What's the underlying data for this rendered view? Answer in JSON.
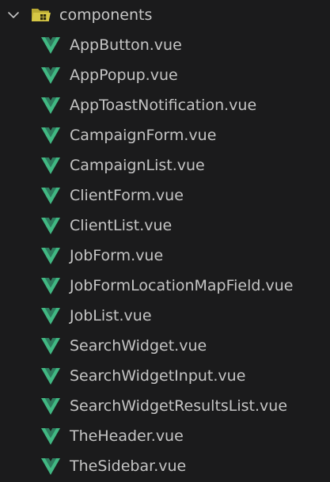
{
  "folder": {
    "name": "components",
    "expanded_icon": "chevron-down-icon",
    "icon": "folder-open-icon",
    "icon_color": "#c8b93a"
  },
  "files": [
    {
      "name": "AppButton.vue"
    },
    {
      "name": "AppPopup.vue"
    },
    {
      "name": "AppToastNotification.vue"
    },
    {
      "name": "CampaignForm.vue"
    },
    {
      "name": "CampaignList.vue"
    },
    {
      "name": "ClientForm.vue"
    },
    {
      "name": "ClientList.vue"
    },
    {
      "name": "JobForm.vue"
    },
    {
      "name": "JobFormLocationMapField.vue"
    },
    {
      "name": "JobList.vue"
    },
    {
      "name": "SearchWidget.vue"
    },
    {
      "name": "SearchWidgetInput.vue"
    },
    {
      "name": "SearchWidgetResultsList.vue"
    },
    {
      "name": "TheHeader.vue"
    },
    {
      "name": "TheSidebar.vue"
    }
  ],
  "file_icon": "vue-logo-icon",
  "colors": {
    "background": "#1b1b1c",
    "text": "#c5c5c5",
    "vue_green": "#41b883",
    "vue_dark": "#2f7d5f"
  }
}
